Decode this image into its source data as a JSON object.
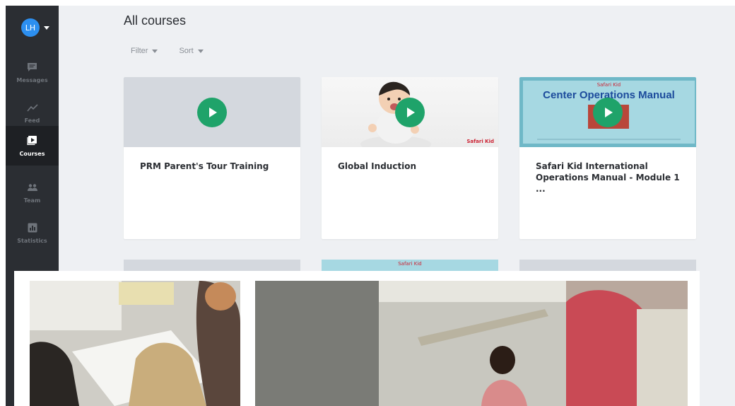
{
  "user": {
    "initials": "LH"
  },
  "nav": [
    {
      "label": "Messages",
      "icon": "message-icon"
    },
    {
      "label": "Feed",
      "icon": "trend-icon"
    },
    {
      "label": "Courses",
      "icon": "courses-icon",
      "active": true
    },
    {
      "label": "Team",
      "icon": "team-icon"
    },
    {
      "label": "Statistics",
      "icon": "statistics-icon"
    }
  ],
  "page": {
    "title": "All courses"
  },
  "toolbar": {
    "filter_label": "Filter",
    "sort_label": "Sort"
  },
  "courses": [
    {
      "title": "PRM Parent's Tour Training",
      "thumb": "blank"
    },
    {
      "title": "Global Induction",
      "thumb": "baby",
      "brand": "Safari Kid"
    },
    {
      "title": "Safari Kid International Operations Manual - Module 1 ...",
      "thumb": "manual",
      "brand": "Safari Kid",
      "heading": "Center Operations Manual"
    }
  ],
  "row2_brand": "Safari Kid",
  "colors": {
    "accent": "#1fa36a",
    "sidebar": "#2b2e33",
    "avatar": "#2c8ff0",
    "heading_blue": "#1c4b9c"
  }
}
